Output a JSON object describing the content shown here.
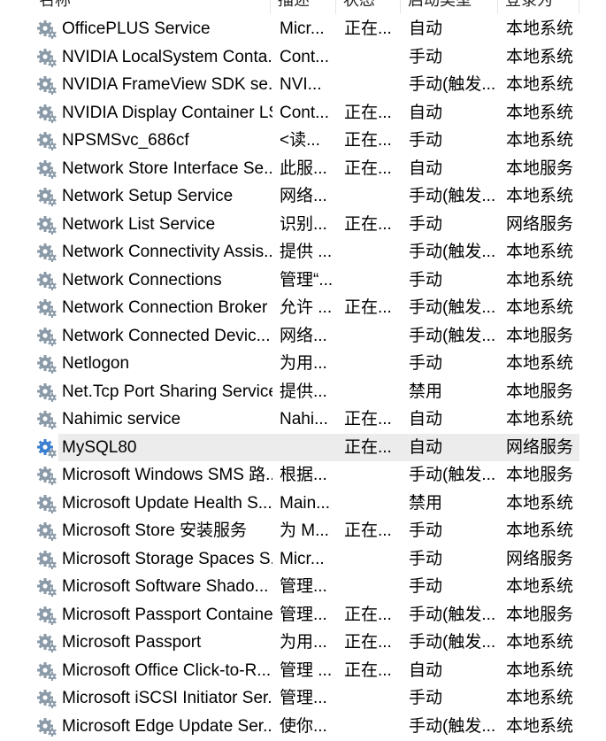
{
  "columns": [
    "名称",
    "描述",
    "状态",
    "启动类型",
    "登录为"
  ],
  "selected_index": 15,
  "colors": {
    "selected_row_bg": "#ececec",
    "gear_gray": "#8a9aa8",
    "gear_blue": "#3a7fd0"
  },
  "rows": [
    {
      "name": "OfficePLUS Service",
      "desc": "Micr...",
      "status": "正在...",
      "start": "自动",
      "logon": "本地系统"
    },
    {
      "name": "NVIDIA LocalSystem Conta...",
      "desc": "Cont...",
      "status": "",
      "start": "手动",
      "logon": "本地系统"
    },
    {
      "name": "NVIDIA FrameView SDK se...",
      "desc": "NVI...",
      "status": "",
      "start": "手动(触发...",
      "logon": "本地系统"
    },
    {
      "name": "NVIDIA Display Container LS",
      "desc": "Cont...",
      "status": "正在...",
      "start": "自动",
      "logon": "本地系统"
    },
    {
      "name": "NPSMSvc_686cf",
      "desc": "<读...",
      "status": "正在...",
      "start": "手动",
      "logon": "本地系统"
    },
    {
      "name": "Network Store Interface Se...",
      "desc": "此服...",
      "status": "正在...",
      "start": "自动",
      "logon": "本地服务"
    },
    {
      "name": "Network Setup Service",
      "desc": "网络...",
      "status": "",
      "start": "手动(触发...",
      "logon": "本地系统"
    },
    {
      "name": "Network List Service",
      "desc": "识别...",
      "status": "正在...",
      "start": "手动",
      "logon": "网络服务"
    },
    {
      "name": "Network Connectivity Assis...",
      "desc": "提供 ...",
      "status": "",
      "start": "手动(触发...",
      "logon": "本地系统"
    },
    {
      "name": "Network Connections",
      "desc": "管理“...",
      "status": "",
      "start": "手动",
      "logon": "本地系统"
    },
    {
      "name": "Network Connection Broker",
      "desc": "允许 ...",
      "status": "正在...",
      "start": "手动(触发...",
      "logon": "本地系统"
    },
    {
      "name": "Network Connected Devic...",
      "desc": "网络...",
      "status": "",
      "start": "手动(触发...",
      "logon": "本地服务"
    },
    {
      "name": "Netlogon",
      "desc": "为用...",
      "status": "",
      "start": "手动",
      "logon": "本地系统"
    },
    {
      "name": "Net.Tcp Port Sharing Service",
      "desc": "提供...",
      "status": "",
      "start": "禁用",
      "logon": "本地服务"
    },
    {
      "name": "Nahimic service",
      "desc": "Nahi...",
      "status": "正在...",
      "start": "自动",
      "logon": "本地系统"
    },
    {
      "name": "MySQL80",
      "desc": "",
      "status": "正在...",
      "start": "自动",
      "logon": "网络服务"
    },
    {
      "name": "Microsoft Windows SMS 路...",
      "desc": "根据...",
      "status": "",
      "start": "手动(触发...",
      "logon": "本地服务"
    },
    {
      "name": "Microsoft Update Health S...",
      "desc": "Main...",
      "status": "",
      "start": "禁用",
      "logon": "本地系统"
    },
    {
      "name": "Microsoft Store 安装服务",
      "desc": "为 M...",
      "status": "正在...",
      "start": "手动",
      "logon": "本地系统"
    },
    {
      "name": "Microsoft Storage Spaces S...",
      "desc": "Micr...",
      "status": "",
      "start": "手动",
      "logon": "网络服务"
    },
    {
      "name": "Microsoft Software Shado...",
      "desc": "管理...",
      "status": "",
      "start": "手动",
      "logon": "本地系统"
    },
    {
      "name": "Microsoft Passport Container",
      "desc": "管理...",
      "status": "正在...",
      "start": "手动(触发...",
      "logon": "本地服务"
    },
    {
      "name": "Microsoft Passport",
      "desc": "为用...",
      "status": "正在...",
      "start": "手动(触发...",
      "logon": "本地系统"
    },
    {
      "name": "Microsoft Office Click-to-R...",
      "desc": "管理 ...",
      "status": "正在...",
      "start": "自动",
      "logon": "本地系统"
    },
    {
      "name": "Microsoft iSCSI Initiator Ser...",
      "desc": "管理...",
      "status": "",
      "start": "手动",
      "logon": "本地系统"
    },
    {
      "name": "Microsoft Edge Update Ser...",
      "desc": "使你...",
      "status": "",
      "start": "手动(触发...",
      "logon": "本地系统"
    }
  ]
}
